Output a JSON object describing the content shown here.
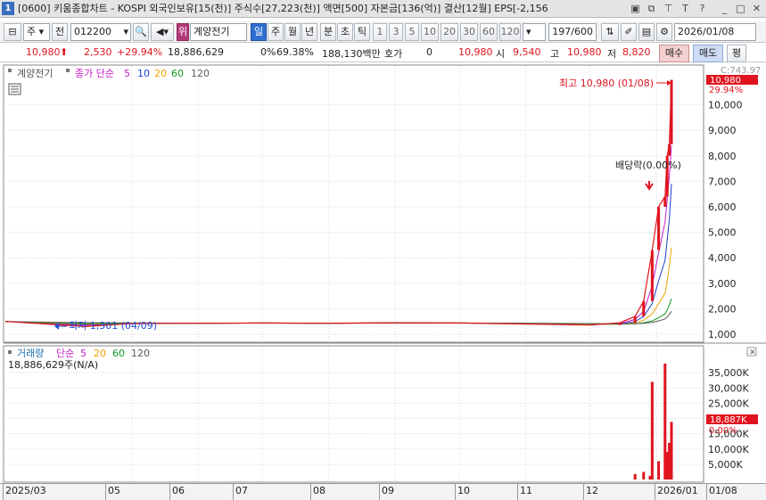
{
  "window": {
    "number": "1",
    "title": "[0600] 키움종합차트 - KOSPI 외국인보유[15(천)] 주식수[27,223(천)] 액면[500] 자본금[136(억)] 결산[12월] EPS[-2,156"
  },
  "toolbar": {
    "type_select": "주",
    "prev_label": "전",
    "code_value": "012200",
    "stock_name": "계양전기",
    "stock_badge": "위",
    "periods": [
      "일",
      "주",
      "월",
      "년",
      "분",
      "초",
      "틱"
    ],
    "active_period": "일",
    "intervals": [
      "1",
      "3",
      "5",
      "10",
      "20",
      "30",
      "60",
      "120"
    ],
    "count_value": "197",
    "count_total": "/600",
    "date_value": "2026/01/08"
  },
  "quote": {
    "price": "10,980",
    "change": "2,530",
    "change_pct": "+29.94%",
    "volume": "18,886,629",
    "vol_ratio": "0%",
    "ratio2": "69.38%",
    "amount": "188,130백만",
    "hoga_label": "호가",
    "hoga_value": "0",
    "price2": "10,980",
    "open_label": "시",
    "open_value": "9,540",
    "high_label": "고",
    "high_value": "10,980",
    "low_label": "저",
    "low_value": "8,820",
    "buy_label": "매수",
    "sell_label": "매도",
    "eval_label": "평"
  },
  "legend": {
    "price_name": "계양전기",
    "ma_label": "종가 단순",
    "ma_periods": [
      "5",
      "10",
      "20",
      "60",
      "120"
    ],
    "volume_name": "거래량",
    "vol_ma_label": "단순",
    "vol_ma_periods": [
      "5",
      "20",
      "60",
      "120"
    ],
    "volume_value": "18,886,629주(N/A)"
  },
  "annotations": {
    "high_text": "최고 10,980 (01/08)",
    "low_text": "최저 1,301 (04/09)",
    "dividend_text": "배당락(0.00%)",
    "price_tag": "10,980",
    "price_tag_pct": "29.94%",
    "price_top_partial": "C:743.97",
    "vol_tag": "18,887K",
    "vol_tag_pct": "0.00%"
  },
  "chart_data": [
    {
      "type": "line",
      "title": "계양전기 일봉",
      "x": [
        "2025/03/03",
        "2025/04/09",
        "2025/05/01",
        "2025/06/02",
        "2025/07/01",
        "2025/08/01",
        "2025/09/01",
        "2025/10/01",
        "2025/11/03",
        "2025/12/01",
        "2025/12/15",
        "2025/12/22",
        "2025/12/26",
        "2025/12/30",
        "2026/01/02",
        "2026/01/05",
        "2026/01/06",
        "2026/01/07",
        "2026/01/08"
      ],
      "series": [
        {
          "name": "종가",
          "values": [
            1500,
            1301,
            1420,
            1430,
            1440,
            1430,
            1450,
            1440,
            1400,
            1360,
            1450,
            1700,
            2300,
            4300,
            6000,
            6400,
            8000,
            8450,
            10980
          ]
        },
        {
          "name": "5",
          "values": [
            1500,
            1350,
            1420,
            1430,
            1440,
            1430,
            1450,
            1440,
            1410,
            1370,
            1420,
            1580,
            1900,
            2900,
            4200,
            5400,
            6300,
            7200,
            8400
          ]
        },
        {
          "name": "10",
          "values": [
            1500,
            1380,
            1420,
            1430,
            1440,
            1430,
            1450,
            1440,
            1410,
            1380,
            1400,
            1500,
            1700,
            2200,
            3100,
            3900,
            4700,
            5500,
            6900
          ]
        },
        {
          "name": "20",
          "values": [
            1500,
            1400,
            1420,
            1430,
            1440,
            1430,
            1450,
            1440,
            1420,
            1390,
            1390,
            1450,
            1550,
            1800,
            2200,
            2600,
            3100,
            3700,
            4400
          ]
        },
        {
          "name": "60",
          "values": [
            1500,
            1420,
            1420,
            1430,
            1440,
            1430,
            1440,
            1440,
            1430,
            1410,
            1400,
            1410,
            1450,
            1520,
            1650,
            1800,
            1950,
            2150,
            2400
          ]
        },
        {
          "name": "120",
          "values": [
            1500,
            1450,
            1440,
            1435,
            1435,
            1430,
            1435,
            1435,
            1430,
            1420,
            1410,
            1410,
            1430,
            1460,
            1520,
            1600,
            1680,
            1780,
            1900
          ]
        }
      ],
      "ylim": [
        1000,
        11000
      ],
      "y_ticks": [
        "1,000",
        "2,000",
        "3,000",
        "4,000",
        "5,000",
        "6,000",
        "7,000",
        "8,000",
        "9,000",
        "10,000"
      ],
      "xlabel": "",
      "ylabel": ""
    },
    {
      "type": "bar",
      "title": "거래량",
      "categories": [
        "2025/12/22",
        "2025/12/26",
        "2025/12/29",
        "2025/12/30",
        "2026/01/02",
        "2026/01/05",
        "2026/01/06",
        "2026/01/07",
        "2026/01/08"
      ],
      "values": [
        1800,
        2500,
        1200,
        32000,
        6000,
        38000,
        9000,
        12000,
        18887
      ],
      "ylim": [
        0,
        40000
      ],
      "y_ticks": [
        "5,000K",
        "10,000K",
        "15,000K",
        "20,000K",
        "25,000K",
        "30,000K",
        "35,000K"
      ],
      "xlabel": "",
      "ylabel": ""
    }
  ],
  "xaxis": {
    "labels": [
      "2025/03",
      "05",
      "06",
      "07",
      "08",
      "09",
      "10",
      "11",
      "12",
      "2026/01",
      "01/08"
    ]
  },
  "colors": {
    "up": "#e0141e",
    "down": "#1a4fd8",
    "ma5": "#c81cc8",
    "ma10": "#1a3fd0",
    "ma20": "#f0a000",
    "ma60": "#109a20",
    "ma120": "#5a5a5a"
  }
}
